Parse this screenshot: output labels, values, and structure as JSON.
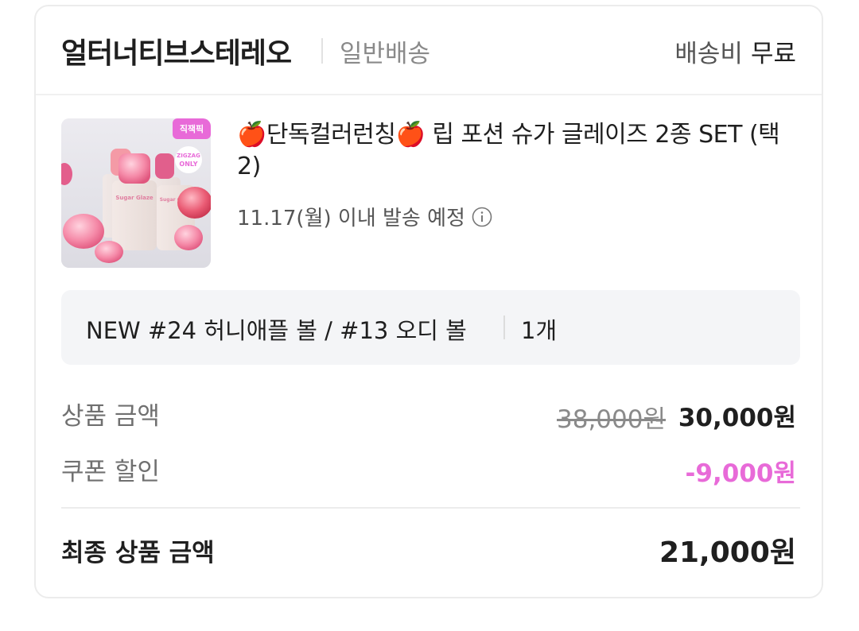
{
  "seller": {
    "name": "얼터너티브스테레오",
    "shipping_type": "일반배송",
    "shipping_fee_label": "배송비",
    "shipping_fee_value": "무료"
  },
  "product": {
    "title": "🍎단독컬러런칭🍎 립 포션 슈가 글레이즈 2종 SET (택2)",
    "ship_date": "11.17(월) 이내 발송 예정",
    "thumbnail": {
      "badge": "직잭픽",
      "sticker_line1": "ZIGZAG",
      "sticker_line2": "ONLY",
      "brand_text": "Sugar Glaze"
    }
  },
  "option": {
    "text": "NEW #24 허니애플 볼 / #13 오디 볼",
    "quantity": "1개"
  },
  "pricing": {
    "product_amount_label": "상품 금액",
    "original_price": "38,000원",
    "sale_price": "30,000원",
    "coupon_label": "쿠폰 할인",
    "coupon_value": "-9,000원",
    "final_label": "최종 상품 금액",
    "final_value": "21,000원"
  },
  "colors": {
    "discount": "#e86ad8",
    "text_primary": "#1f1f1f",
    "text_secondary": "#707070",
    "option_bg": "#f4f5f7"
  },
  "icons": {
    "info": "info-circle-icon"
  }
}
